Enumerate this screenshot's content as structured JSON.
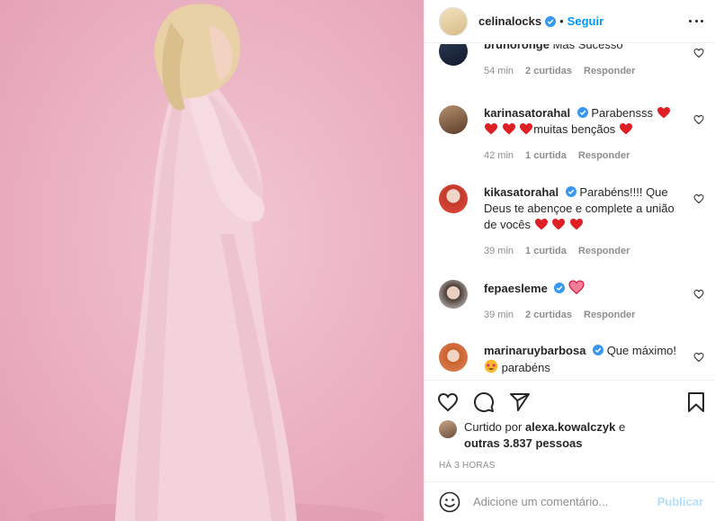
{
  "post": {
    "username": "celinalocks",
    "follow_label": "Seguir",
    "separator": "•"
  },
  "comments": [
    {
      "username": "brunoronge",
      "text": "Mas Sucesso",
      "time": "54 min",
      "likes": "2 curtidas",
      "reply": "Responder"
    },
    {
      "username": "karinasatorahal",
      "text_before": "Parabensss",
      "text_after": "muitas bençãos",
      "time": "42 min",
      "likes": "1 curtida",
      "reply": "Responder"
    },
    {
      "username": "kikasatorahal",
      "text": "Parabéns!!!! Que Deus te abençoe e complete a união de vocês",
      "time": "39 min",
      "likes": "1 curtida",
      "reply": "Responder"
    },
    {
      "username": "fepaesleme",
      "time": "39 min",
      "likes": "2 curtidas",
      "reply": "Responder"
    },
    {
      "username": "marinaruybarbosa",
      "text": "Que máximo!",
      "text_after": "parabéns"
    }
  ],
  "likes": {
    "prefix": "Curtido por",
    "user": "alexa.kowalczyk",
    "mid": "e",
    "others": "outras 3.837 pessoas"
  },
  "timestamp": "HÁ 3 HORAS",
  "add_comment": {
    "placeholder": "Adicione um comentário...",
    "publish_label": "Publicar"
  },
  "icons": {
    "verified": "verified-badge-icon",
    "heart": "heart-icon",
    "comment": "comment-icon",
    "share": "share-icon",
    "save": "save-icon",
    "emoji": "emoji-icon",
    "more": "more-options-icon"
  },
  "colors": {
    "accent": "#0095f6",
    "publish_disabled": "#b2dffc",
    "muted": "#8e8e8e",
    "red_heart": "#e0245e",
    "photo_bg": "#eab0c1"
  }
}
